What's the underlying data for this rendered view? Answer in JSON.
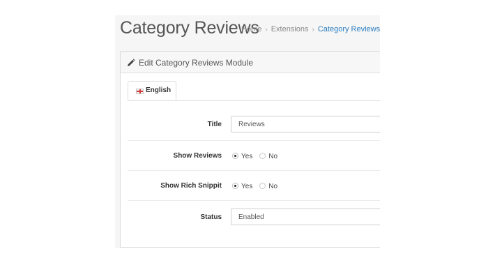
{
  "header": {
    "title": "Category Reviews",
    "breadcrumb": [
      "Home",
      "Extensions",
      "Category Reviews"
    ],
    "breadcrumb_separator": "›"
  },
  "panel": {
    "heading": "Edit Category Reviews Module",
    "heading_icon": "pencil-icon"
  },
  "tabs": [
    {
      "label": "English",
      "icon": "uk-flag-icon",
      "active": true
    }
  ],
  "form": {
    "title": {
      "label": "Title",
      "value": "Reviews"
    },
    "show_reviews": {
      "label": "Show Reviews",
      "options": [
        {
          "label": "Yes",
          "checked": true
        },
        {
          "label": "No",
          "checked": false
        }
      ]
    },
    "show_rich_snippet": {
      "label": "Show Rich Snippit",
      "options": [
        {
          "label": "Yes",
          "checked": true
        },
        {
          "label": "No",
          "checked": false
        }
      ]
    },
    "status": {
      "label": "Status",
      "value": "Enabled"
    }
  },
  "colors": {
    "link": "#2a7dc0",
    "panel_border": "#dcdcdc",
    "heading_bg": "#f7f7f7"
  }
}
